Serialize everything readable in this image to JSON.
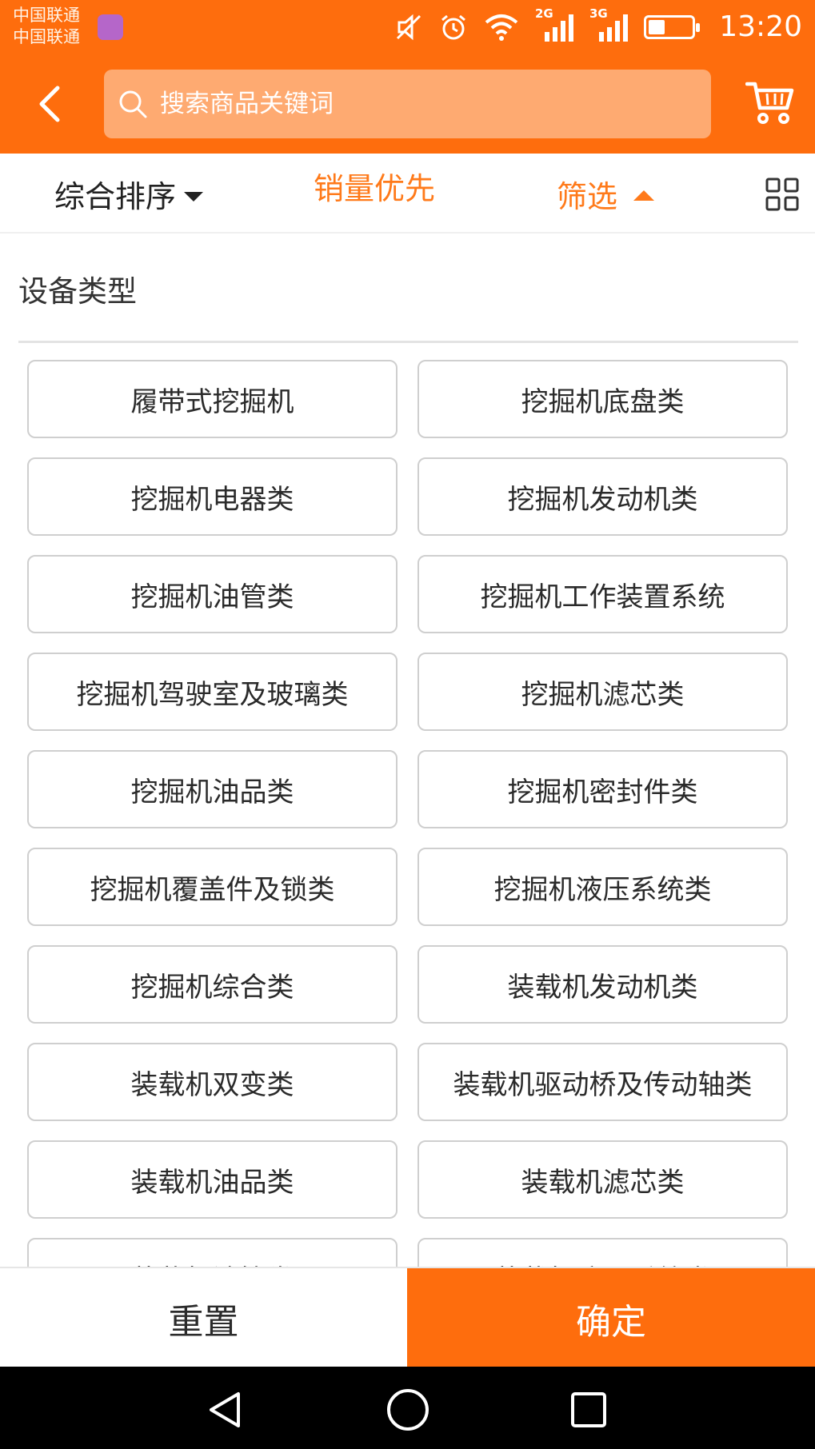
{
  "status_bar": {
    "carrier_1": "中国联通",
    "carrier_2": "中国联通",
    "network_1": "2G",
    "network_2": "3G",
    "time": "13:20"
  },
  "header": {
    "search_placeholder": "搜索商品关键词",
    "icons": [
      "back-arrow-icon",
      "search-icon",
      "cart-icon"
    ]
  },
  "sort_bar": {
    "default_sort": "综合排序",
    "sales_first": "销量优先",
    "filter": "筛选",
    "active_color": "#ff7a1a"
  },
  "filter_panel": {
    "section_title": "设备类型",
    "options": [
      "履带式挖掘机",
      "挖掘机底盘类",
      "挖掘机电器类",
      "挖掘机发动机类",
      "挖掘机油管类",
      "挖掘机工作装置系统",
      "挖掘机驾驶室及玻璃类",
      "挖掘机滤芯类",
      "挖掘机油品类",
      "挖掘机密封件类",
      "挖掘机覆盖件及锁类",
      "挖掘机液压系统类",
      "挖掘机综合类",
      "装载机发动机类",
      "装载机双变类",
      "装载机驱动桥及传动轴类",
      "装载机油品类",
      "装载机滤芯类",
      "装载机油管类",
      "装载机液压系统类"
    ]
  },
  "actions": {
    "reset": "重置",
    "confirm": "确定"
  },
  "colors": {
    "brand_orange": "#fe6d0d",
    "search_bg": "#feaa71"
  }
}
